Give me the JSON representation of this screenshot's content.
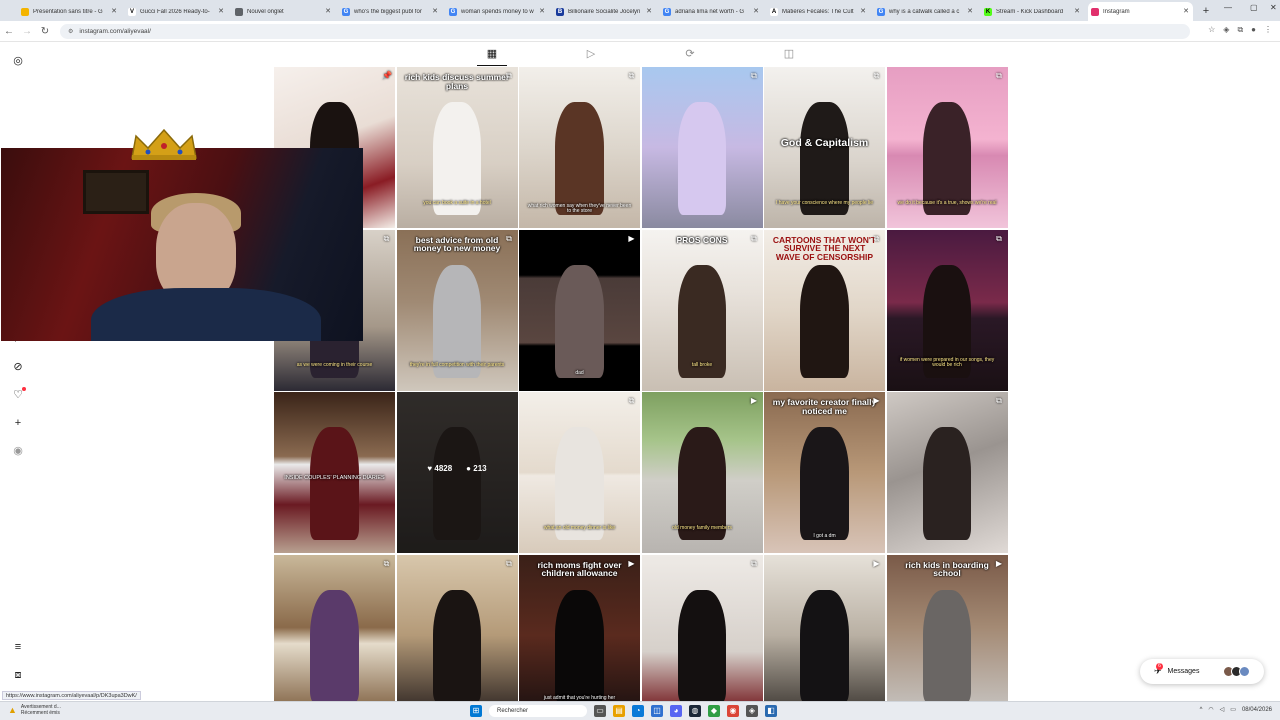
{
  "browser": {
    "tabs": [
      {
        "label": "Présentation sans titre - G",
        "fav_bg": "#f4b400",
        "fav_char": ""
      },
      {
        "label": "Gucci Fall 2026 Ready-to-",
        "fav_bg": "#ffffff",
        "fav_char": "V",
        "fav_fg": "#000"
      },
      {
        "label": "Nouvel onglet",
        "fav_bg": "#5f6368",
        "fav_char": ""
      },
      {
        "label": "who's the biggest publ for",
        "fav_bg": "#4285f4",
        "fav_char": "G"
      },
      {
        "label": "woman spends money to w",
        "fav_bg": "#4285f4",
        "fav_char": "G"
      },
      {
        "label": "Billionaire Socialite Jocelyn",
        "fav_bg": "#1a3b9c",
        "fav_char": "B"
      },
      {
        "label": "adriana lima net worth - G",
        "fav_bg": "#4285f4",
        "fav_char": "G"
      },
      {
        "label": "Matières Fécales: The Cult",
        "fav_bg": "#ffffff",
        "fav_char": "A",
        "fav_fg": "#000"
      },
      {
        "label": "why is a catwalk called a c",
        "fav_bg": "#4285f4",
        "fav_char": "G"
      },
      {
        "label": "Stream - Kick Dashboard",
        "fav_bg": "#53fc18",
        "fav_char": "K",
        "fav_fg": "#000"
      },
      {
        "label": "Instagram",
        "fav_bg": "#e1306c",
        "fav_char": "",
        "active": true
      }
    ],
    "url": "instagram.com/aliyevaal/",
    "status_url": "https://www.instagram.com/aliyevaal/p/DK3upa3DwK/"
  },
  "profile_tabs": [
    {
      "name": "tab-posts-icon",
      "glyph": "▦"
    },
    {
      "name": "tab-reels-icon",
      "glyph": "▷"
    },
    {
      "name": "tab-reposts-icon",
      "glyph": "⟳"
    },
    {
      "name": "tab-tagged-icon",
      "glyph": "◫"
    }
  ],
  "posts": [
    {
      "bg": "linear-gradient(160deg,#f6f0ec 0%,#e9ddd5 45%,#8a1c24 75%,#f4eee8 100%)",
      "caption": "",
      "badge": "📌",
      "fig": "#1a1210"
    },
    {
      "bg": "linear-gradient(180deg,#e8e2da 0%,#d8cfc4 60%,#b9aea2 100%)",
      "caption": "rich kids discuss summer plans",
      "cls": "top",
      "sub": "you can book a suite in a hotel",
      "badge": "⧉",
      "fig": "#f3f1ee"
    },
    {
      "bg": "linear-gradient(180deg,#f2efea 0%,#ddd6cc 50%,#c4b7a8 100%)",
      "caption": "",
      "small": "what rich women say when they've never been to the store",
      "badge": "⧉",
      "fig": "#5a3525"
    },
    {
      "bg": "linear-gradient(180deg,#a8c8ef 0%,#c7b9e3 50%,#8a8aa0 100%)",
      "caption": "",
      "badge": "⧉",
      "fig": "#d6c8ef"
    },
    {
      "bg": "linear-gradient(180deg,#f3f1ee 0%,#d9d3cb 60%,#bdb4a9 100%)",
      "caption": "God & Capitalism",
      "cls": "big",
      "sub": "I have your conscience where my people lie",
      "badge": "⧉",
      "fig": "#1f1a18"
    },
    {
      "bg": "linear-gradient(180deg,#e69ec2 0%,#f4b3d0 45%,#d889b2 55%,#f1c4da 100%)",
      "caption": "",
      "sub": "we do it because it's a true, shows we're real",
      "badge": "⧉",
      "fig": "#3a2228"
    },
    {
      "bg": "linear-gradient(180deg,#d8d1c8 0%,#a59889 60%,#2c2a34 100%)",
      "caption": "",
      "sub": "as we were coming in their course",
      "badge": "⧉",
      "fig": "#2a2230"
    },
    {
      "bg": "linear-gradient(180deg,#8a7057 0%,#a08a74 45%,#cfc7bc 100%)",
      "caption": "best advice from old money to new money",
      "cls": "top",
      "sub": "they're in full competition with their parents",
      "badge": "⧉",
      "fig": "#b6b6b8"
    },
    {
      "bg": "linear-gradient(180deg,#000 0%,#000 28%,#4a3b38 30%,#5a4640 70%,#000 72%,#000 100%)",
      "caption": "",
      "small": "dad",
      "badge": "▶",
      "fig": "#6a5a58"
    },
    {
      "bg": "linear-gradient(180deg,#f5f3f0 0%,#e7e1da 40%,#c9bfb3 100%)",
      "caption": "PROS   CONS",
      "cls": "top",
      "sub": "tall     broke",
      "badge": "⧉",
      "fig": "#3a2a22"
    },
    {
      "bg": "linear-gradient(180deg,#f2ede6 0%,#e1d6c8 50%,#c9b49f 100%)",
      "caption": "CARTOONS THAT WON'T SURVIVE THE NEXT WAVE OF CENSORSHIP",
      "cls": "top",
      "dark": true,
      "badge": "⧉",
      "fig": "#201612"
    },
    {
      "bg": "linear-gradient(180deg,#4a1a40 0%,#7a2a4a 45%,#2a1826 55%,#1a1014 100%)",
      "caption": "",
      "sub": "if women were prepared in our songs, they would be rich",
      "badge": "⧉",
      "fig": "#1a1010"
    },
    {
      "bg": "linear-gradient(180deg,#3a2418 0%,#8a6a50 40%,#eaeaea 45%,#6a1a22 70%,#b8a090 100%)",
      "caption": "INSIDE COUPLES' PLANNING DIARIES",
      "cls": "mid2",
      "badge": "",
      "fig": "#5a1418"
    },
    {
      "bg": "linear-gradient(180deg,#4a4440 0%,#2e2a28 100%)",
      "caption": "",
      "badge": "",
      "dim": true,
      "likes": "4828",
      "comments": "213",
      "fig": "#2a2220"
    },
    {
      "bg": "linear-gradient(180deg,#f3efe9 0%,#e4dacd 50%,#efe9e2 52%,#d8cbbb 100%)",
      "caption": "",
      "sub": "what an old money dinner is like",
      "badge": "⧉",
      "fig": "#e8e4df"
    },
    {
      "bg": "linear-gradient(180deg,#7ea060 0%,#a6c48a 30%,#d0cec8 55%,#b8b4b0 100%)",
      "caption": "",
      "sub": "old money family members",
      "badge": "▶",
      "fig": "#2a1a18"
    },
    {
      "bg": "linear-gradient(180deg,#8a6a50 0%,#b89878 50%,#d8c4b8 100%)",
      "caption": "my favorite creator finally noticed me",
      "cls": "top",
      "small": "I got a dm",
      "badge": "▶",
      "fig": "#1a1618"
    },
    {
      "bg": "linear-gradient(160deg,#cfc9c4 0%,#9a9490 45%,#e0dad6 100%)",
      "caption": "",
      "badge": "⧉",
      "fig": "#2a2220"
    },
    {
      "bg": "linear-gradient(180deg,#c9b89a 0%,#8a6a4a 45%,#e5dccb 55%,#7a5a3a 100%)",
      "caption": "",
      "badge": "⧉",
      "fig": "#5a3a6a"
    },
    {
      "bg": "linear-gradient(180deg,#d8c7ac 0%,#b49a78 50%,#2a2220 100%)",
      "caption": "",
      "badge": "⧉",
      "fig": "#1a1412"
    },
    {
      "bg": "linear-gradient(180deg,#3a2018 0%,#5a2a1e 50%,#1a1010 100%)",
      "caption": "rich moms fight over children allowance",
      "cls": "top",
      "small": "just admit that you're hurting her",
      "badge": "▶",
      "fig": "#0a0808"
    },
    {
      "bg": "linear-gradient(180deg,#eeeae6 0%,#d6d0ca 60%,#6a0a10 100%)",
      "caption": "",
      "badge": "⧉",
      "fig": "#141010"
    },
    {
      "bg": "linear-gradient(180deg,#e6e1d9 0%,#b9b0a3 50%,#3a3530 100%)",
      "caption": "",
      "badge": "▶",
      "fig": "#141214"
    },
    {
      "bg": "linear-gradient(180deg,#7a5a48 0%,#a48a74 45%,#c8c6c4 100%)",
      "caption": "rich kids in boarding school",
      "cls": "top",
      "badge": "▶",
      "fig": "#6a6664"
    }
  ],
  "messages": {
    "label": "Messages",
    "count": "6"
  },
  "taskbar": {
    "warning_line1": "Avertissement d...",
    "warning_line2": "Récemment émis",
    "search_placeholder": "Rechercher",
    "date": "08/04/2026"
  }
}
